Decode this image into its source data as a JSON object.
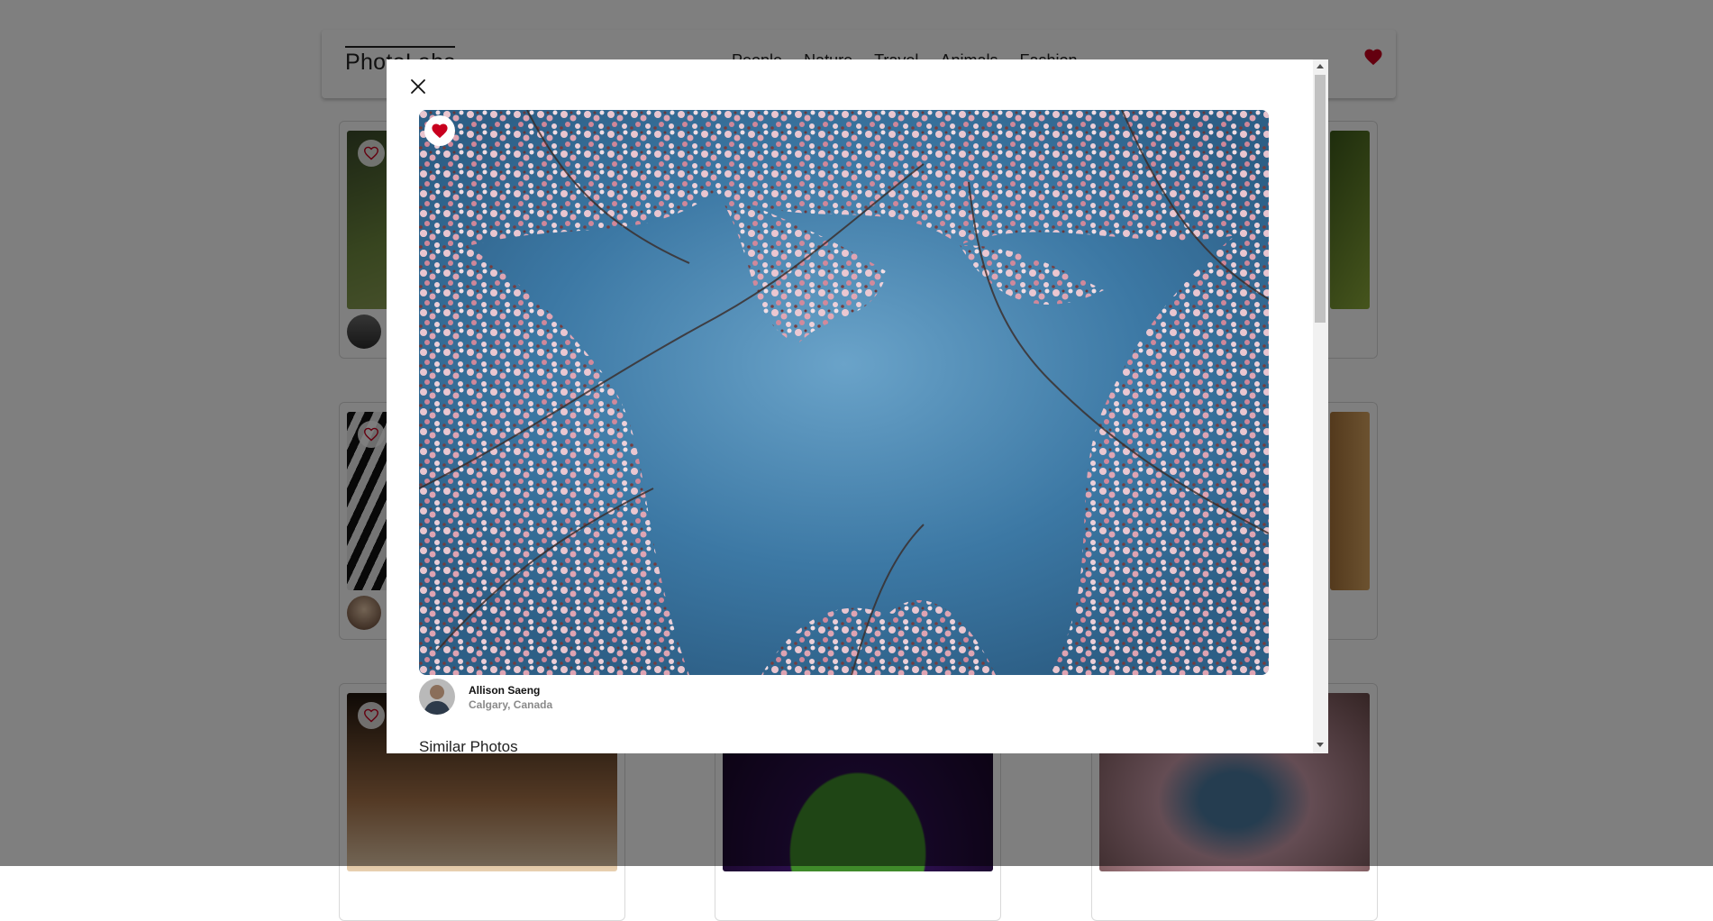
{
  "app": {
    "logo": "PhotoLabs"
  },
  "nav": {
    "items": [
      "People",
      "Nature",
      "Travel",
      "Animals",
      "Fashion"
    ]
  },
  "colors": {
    "accent": "#c8001e",
    "overlay": "rgba(0,0,0,0.5)"
  },
  "modal": {
    "close_icon": "close-icon",
    "photo": {
      "favorited": true,
      "alt": "Pink cherry blossom branches against blue sky"
    },
    "author": {
      "name": "Allison Saeng",
      "location": "Calgary, Canada"
    },
    "similar_heading": "Similar Photos"
  },
  "icons": {
    "favorite": "heart-icon",
    "close": "close-icon"
  }
}
